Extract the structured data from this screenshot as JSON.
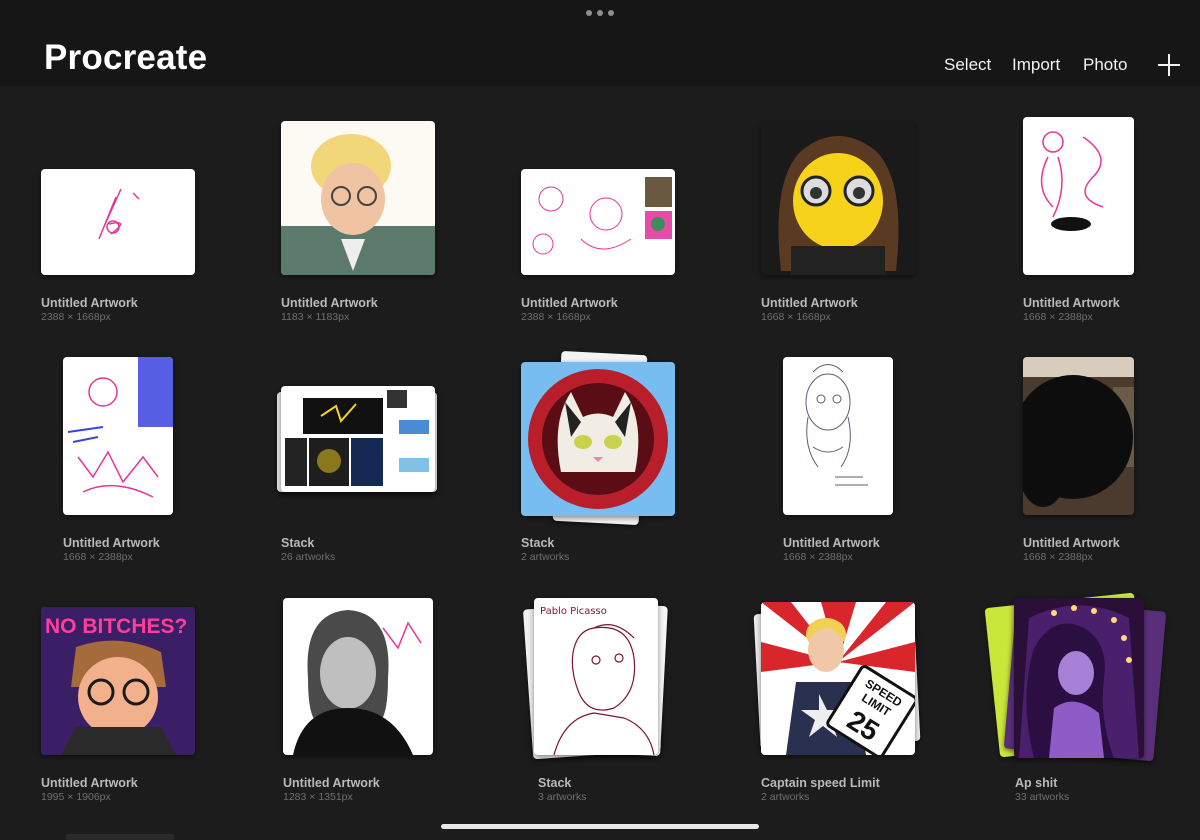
{
  "app": {
    "title": "Procreate"
  },
  "toolbar": {
    "select": "Select",
    "import": "Import",
    "photo": "Photo",
    "new_icon": "plus-icon"
  },
  "items": [
    {
      "title": "Untitled Artwork",
      "sub": "2388 × 1668px"
    },
    {
      "title": "Untitled Artwork",
      "sub": "1183 × 1183px"
    },
    {
      "title": "Untitled Artwork",
      "sub": "2388 × 1668px"
    },
    {
      "title": "Untitled Artwork",
      "sub": "1668 × 1668px"
    },
    {
      "title": "Untitled Artwork",
      "sub": "1668 × 2388px"
    },
    {
      "title": "Untitled Artwork",
      "sub": "1668 × 2388px"
    },
    {
      "title": "Stack",
      "sub": "26 artworks"
    },
    {
      "title": "Stack",
      "sub": "2 artworks"
    },
    {
      "title": "Untitled Artwork",
      "sub": "1668 × 2388px"
    },
    {
      "title": "Untitled Artwork",
      "sub": "1668 × 2388px"
    },
    {
      "title": "Untitled Artwork",
      "sub": "1995 × 1906px"
    },
    {
      "title": "Untitled Artwork",
      "sub": "1283 × 1351px"
    },
    {
      "title": "Stack",
      "sub": "3 artworks"
    },
    {
      "title": "Captain speed Limit",
      "sub": "2 artworks"
    },
    {
      "title": "Ap shit",
      "sub": "33 artworks"
    }
  ],
  "artwork_text": {
    "no_bitches": "NO BITCHES?",
    "speed": "SPEED",
    "limit": "LIMIT",
    "speed_number": "25",
    "picasso": "Pablo Picasso"
  },
  "colors": {
    "background": "#1c1c1c",
    "topbar": "#161616",
    "caption": "#b9b9b9",
    "subcaption": "#6f6f6f"
  }
}
